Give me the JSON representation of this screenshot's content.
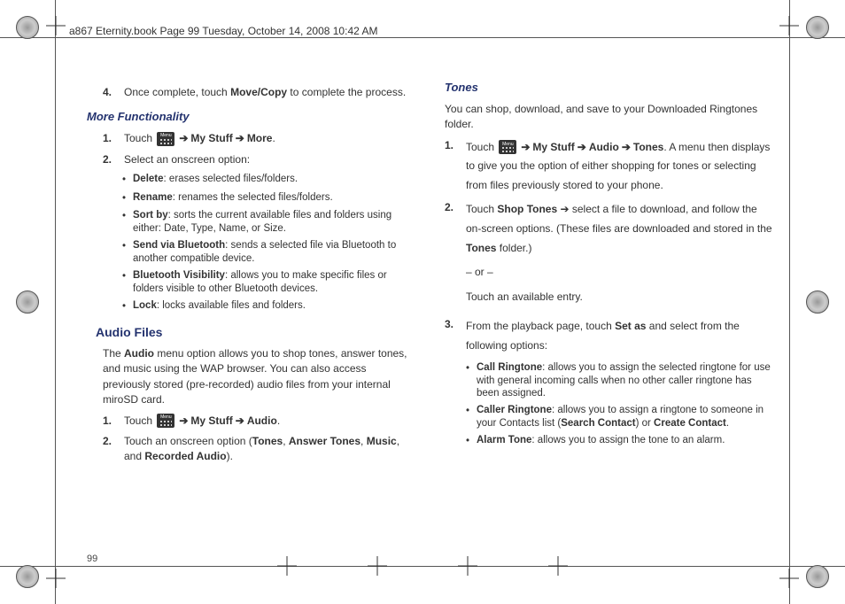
{
  "header": "a867 Eternity.book  Page 99  Tuesday, October 14, 2008  10:42 AM",
  "page_number": "99",
  "left": {
    "step4": {
      "num": "4.",
      "pre": "Once complete, touch ",
      "b": "Move/Copy",
      "post": " to complete the process."
    },
    "more_func_h": "More Functionality",
    "mf1": {
      "num": "1.",
      "touch": "Touch ",
      "arrow": " ➔ ",
      "b1": "My Stuff",
      "b2": "More",
      "end": "."
    },
    "mf2": {
      "num": "2.",
      "text": "Select an onscreen option:"
    },
    "bullets": {
      "delete": {
        "b": "Delete",
        "t": ": erases selected files/folders."
      },
      "rename": {
        "b": "Rename",
        "t": ": renames the selected files/folders."
      },
      "sortby": {
        "b": "Sort by",
        "t": ": sorts the current available files and folders using either: Date, Type, Name, or Size."
      },
      "sendbt": {
        "b": "Send via Bluetooth",
        "t": ": sends a selected file via Bluetooth to another compatible device."
      },
      "btvis": {
        "b": "Bluetooth Visibility",
        "t": ": allows you to make specific files or folders visible to other Bluetooth devices."
      },
      "lock": {
        "b": "Lock",
        "t": ": locks available files and folders."
      }
    },
    "audio_h": "Audio Files",
    "audio_para": {
      "pre": "The ",
      "b": "Audio",
      "post": " menu option allows you to shop tones, answer tones, and music using the WAP browser. You can also access previously stored (pre-recorded) audio files from your internal miroSD card."
    },
    "af1": {
      "num": "1.",
      "touch": "Touch ",
      "arrow": " ➔ ",
      "b1": "My Stuff",
      "b2": "Audio",
      "end": "."
    },
    "af2": {
      "num": "2.",
      "pre": "Touch an onscreen option (",
      "b1": "Tones",
      "c1": ", ",
      "b2": "Answer Tones",
      "c2": ", ",
      "b3": "Music",
      "c3": ", and ",
      "b4": "Recorded Audio",
      "end": ")."
    }
  },
  "right": {
    "tones_h": "Tones",
    "tones_intro": "You can shop, download, and save to your Downloaded Ringtones folder.",
    "t1": {
      "num": "1.",
      "touch": "Touch ",
      "arrow": " ➔ ",
      "b1": "My Stuff",
      "b2": "Audio",
      "b3": "Tones",
      "post": ". A menu then displays to give you the option of either shopping for tones or selecting from files previously stored to your phone."
    },
    "t2": {
      "num": "2.",
      "pre": "Touch ",
      "b1": "Shop Tones",
      "mid": " ➔ select a file to download, and follow the on-screen options. (These files are downloaded and stored in the ",
      "b2": "Tones",
      "post": " folder.)"
    },
    "or": "– or –",
    "touch_avail": "Touch an available entry.",
    "t3": {
      "num": "3.",
      "pre": "From the playback page, touch ",
      "b": "Set as",
      "post": " and select from the following options:"
    },
    "bullets": {
      "callring": {
        "b": "Call Ringtone",
        "t": ": allows you to assign the selected ringtone for use with general incoming calls when no other caller ringtone has been assigned."
      },
      "callerring": {
        "b": "Caller Ringtone",
        "pre": ": allows you to assign a ringtone to someone in your Contacts list (",
        "b2": "Search Contact",
        "mid": ") or ",
        "b3": "Create Contact",
        "end": "."
      },
      "alarm": {
        "b": "Alarm Tone",
        "t": ": allows you to assign the tone to an alarm."
      }
    }
  }
}
